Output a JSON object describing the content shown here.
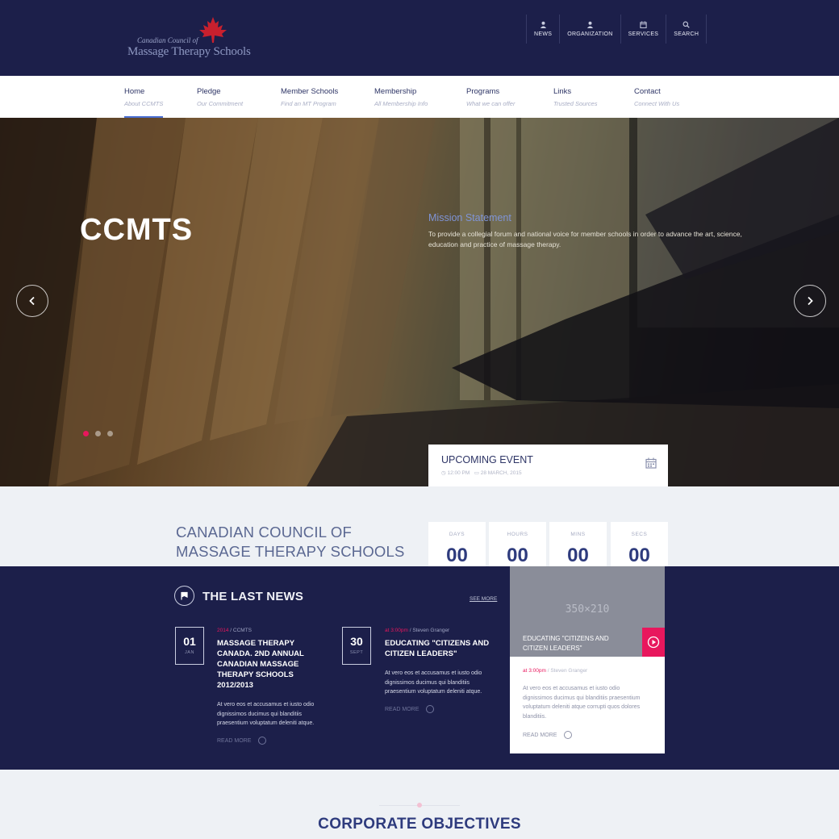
{
  "header": {
    "logo_line1": "Canadian Council of",
    "logo_line2": "Massage Therapy Schools",
    "quick_links": [
      {
        "label": "NEWS",
        "icon": "user-icon"
      },
      {
        "label": "ORGANIZATION",
        "icon": "user-icon"
      },
      {
        "label": "SERVICES",
        "icon": "calendar-icon"
      },
      {
        "label": "SEARCH",
        "icon": "search-icon"
      }
    ]
  },
  "nav": {
    "items": [
      {
        "label": "Home",
        "sub": "About CCMTS",
        "active": true
      },
      {
        "label": "Pledge",
        "sub": "Our Commitment"
      },
      {
        "label": "Member Schools",
        "sub": "Find an MT Program"
      },
      {
        "label": "Membership",
        "sub": "All Membership Info"
      },
      {
        "label": "Programs",
        "sub": "What we can offer"
      },
      {
        "label": "Links",
        "sub": "Trusted Sources"
      },
      {
        "label": "Contact",
        "sub": "Connect With Us"
      }
    ]
  },
  "hero": {
    "title": "CCMTS",
    "mission_heading": "Mission Statement",
    "mission_text": "To provide a collegial forum and national voice for member schools in order to advance the art, science, education and practice of massage therapy.",
    "slide_count": 3,
    "active_slide": 1
  },
  "event": {
    "title": "UPCOMING EVENT",
    "time": "12:00 PM",
    "date": "28 MARCH, 2015"
  },
  "council": {
    "line1": "CANADIAN COUNCIL OF",
    "line2": "MASSAGE THERAPY SCHOOLS"
  },
  "countdown": [
    {
      "label": "DAYS",
      "value": "00"
    },
    {
      "label": "HOURS",
      "value": "00"
    },
    {
      "label": "MINS",
      "value": "00"
    },
    {
      "label": "SECS",
      "value": "00"
    }
  ],
  "news": {
    "title": "THE LAST NEWS",
    "see_more": "SEE MORE",
    "articles": [
      {
        "day": "01",
        "month": "JAN",
        "meta_accent": "2014",
        "meta_rest": " / CCMTS",
        "title": "MASSAGE THERAPY CANADA. 2ND ANNUAL CANADIAN MASSAGE THERAPY SCHOOLS 2012/2013",
        "body": "At vero eos et accusamus et iusto odio dignissimos ducimus qui blanditiis praesentium voluptatum deleniti atque.",
        "read_more": "READ MORE"
      },
      {
        "day": "30",
        "month": "SEPT",
        "meta_accent": "at 3:00pm",
        "meta_rest": " / Steven Granger",
        "title": "EDUCATING \"CITIZENS AND CITIZEN LEADERS\"",
        "body": "At vero eos et accusamus et iusto odio dignissimos ducimus qui blanditiis praesentium voluptatum deleniti atque.",
        "read_more": "READ MORE"
      }
    ],
    "featured": {
      "placeholder": "350×210",
      "caption": "EDUCATING \"CITIZENS AND CITIZEN LEADERS\"",
      "meta_accent": "at 3:00pm",
      "meta_rest": " / Steven Granger",
      "body": "At vero eos et accusamus et iusto odio dignissimos ducimus qui blanditiis praesentium voluptatum deleniti atque corrupti quos dolores blanditiis.",
      "read_more": "READ MORE"
    }
  },
  "objectives": {
    "title": "CORPORATE OBJECTIVES"
  },
  "colors": {
    "navy": "#1c1f4a",
    "accent_pink": "#e8175d",
    "blue_text": "#2e3b7d",
    "logo_leaf": "#c8202e"
  }
}
